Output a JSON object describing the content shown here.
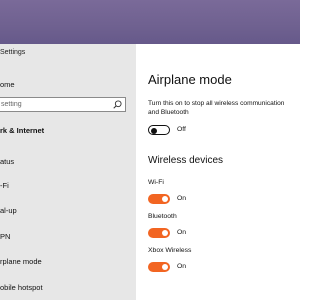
{
  "window": {
    "title": "Settings"
  },
  "sidebar": {
    "home_label": "ome",
    "search_placeholder": "setting",
    "section_title": "rk & Internet",
    "items": [
      {
        "label": "atus",
        "icon": "status-icon"
      },
      {
        "label": "-Fi",
        "icon": "wifi-icon"
      },
      {
        "label": "al-up",
        "icon": "dialup-icon"
      },
      {
        "label": "PN",
        "icon": "vpn-icon"
      },
      {
        "label": "rplane mode",
        "icon": "airplane-icon"
      },
      {
        "label": "obile hotspot",
        "icon": "hotspot-icon"
      }
    ]
  },
  "main": {
    "title": "Airplane mode",
    "description_line1": "Turn this on to stop all wireless communication",
    "description_line2": "and Bluetooth",
    "airplane_state": "Off",
    "section_title": "Wireless devices",
    "devices": [
      {
        "label": "Wi-Fi",
        "state": "On"
      },
      {
        "label": "Bluetooth",
        "state": "On"
      },
      {
        "label": "Xbox Wireless",
        "state": "On"
      }
    ]
  },
  "colors": {
    "toggle_on": "#f26522",
    "sidebar_bg": "#e7e7e7",
    "wallpaper": "#6f6190"
  }
}
